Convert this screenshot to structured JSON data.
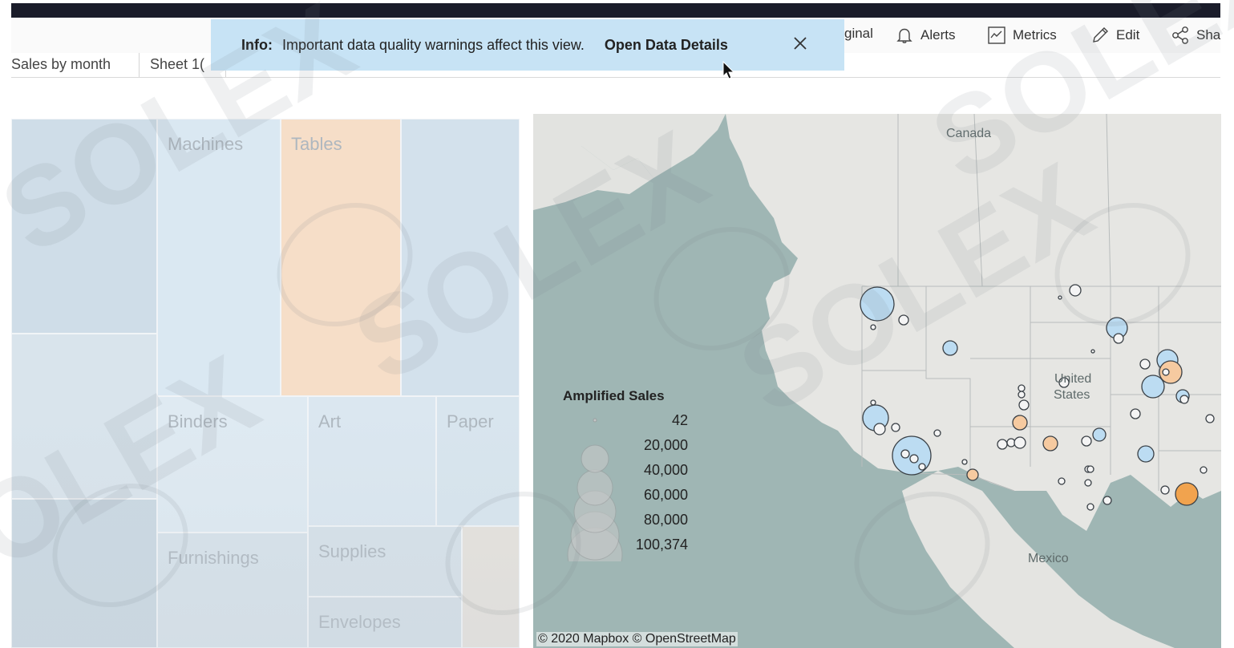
{
  "toolbar": {
    "original_label": "ginal",
    "alerts_label": "Alerts",
    "metrics_label": "Metrics",
    "edit_label": "Edit",
    "share_label": "Sha"
  },
  "tabs": [
    {
      "label": "Sales by month"
    },
    {
      "label": "Sheet 1("
    }
  ],
  "info_banner": {
    "label": "Info:",
    "message": "Important data quality warnings affect this view.",
    "link": "Open Data Details"
  },
  "treemap": {
    "cells": [
      {
        "label": ""
      },
      {
        "label": "Machines"
      },
      {
        "label": "Tables"
      },
      {
        "label": ""
      },
      {
        "label": ""
      },
      {
        "label": "Binders"
      },
      {
        "label": "Art"
      },
      {
        "label": "Paper"
      },
      {
        "label": ""
      },
      {
        "label": "Furnishings"
      },
      {
        "label": "Supplies"
      },
      {
        "label": ""
      },
      {
        "label": "Envelopes"
      }
    ]
  },
  "map": {
    "labels": {
      "canada": "Canada",
      "united": "United",
      "states": "States",
      "mexico": "Mexico"
    },
    "attribution": "© 2020 Mapbox  © OpenStreetMap",
    "legend": {
      "title": "Amplified Sales",
      "values": [
        "42",
        "20,000",
        "40,000",
        "60,000",
        "80,000",
        "100,374"
      ]
    },
    "colors": {
      "water": "#9fb6b4",
      "land": "#e6e6e3",
      "circle_blue": "#bcdcf2",
      "circle_peach": "#f6caa0",
      "circle_orange": "#f1a34e"
    }
  },
  "watermark": "SOLEX"
}
